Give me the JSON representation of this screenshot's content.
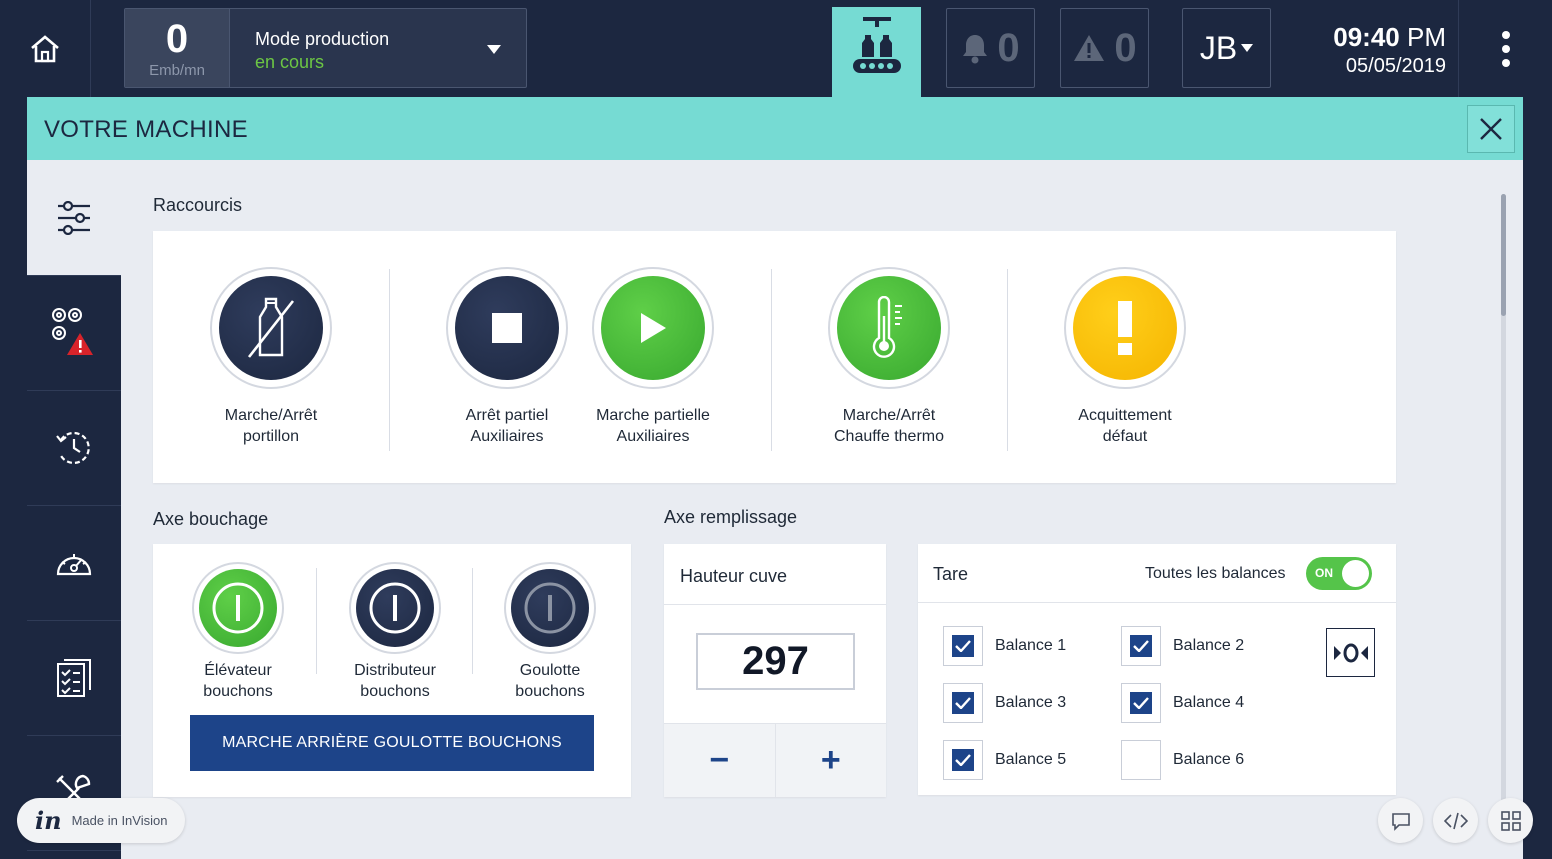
{
  "topbar": {
    "production_count": "0",
    "production_unit": "Emb/mn",
    "mode_label": "Mode production",
    "mode_status": "en cours",
    "notifications_count": "0",
    "warnings_count": "0",
    "user_initials": "JB",
    "time": "09:40",
    "ampm": "PM",
    "date": "05/05/2019"
  },
  "panel": {
    "title": "VOTRE MACHINE"
  },
  "sidebar": {
    "items": [
      {
        "icon": "settings-sliders-icon",
        "active": true
      },
      {
        "icon": "gears-warning-icon",
        "active": false
      },
      {
        "icon": "history-icon",
        "active": false
      },
      {
        "icon": "speedometer-icon",
        "active": false
      },
      {
        "icon": "checklist-icon",
        "active": false
      },
      {
        "icon": "tools-icon",
        "active": false
      }
    ]
  },
  "shortcuts": {
    "title": "Raccourcis",
    "items": [
      {
        "line1": "Marche/Arrêt",
        "line2": "portillon",
        "icon": "bottle-off-icon",
        "color": "dark"
      },
      {
        "line1": "Arrêt partiel",
        "line2": "Auxiliaires",
        "icon": "stop-icon",
        "color": "dark"
      },
      {
        "line1": "Marche partielle",
        "line2": "Auxiliaires",
        "icon": "play-icon",
        "color": "green"
      },
      {
        "line1": "Marche/Arrêt",
        "line2": "Chauffe thermo",
        "icon": "thermometer-icon",
        "color": "green"
      },
      {
        "line1": "Acquittement",
        "line2": "défaut",
        "icon": "exclamation-icon",
        "color": "yellow"
      }
    ]
  },
  "axe_bouchage": {
    "title": "Axe bouchage",
    "items": [
      {
        "line1": "Élévateur",
        "line2": "bouchons",
        "state": "on"
      },
      {
        "line1": "Distributeur",
        "line2": "bouchons",
        "state": "off"
      },
      {
        "line1": "Goulotte",
        "line2": "bouchons",
        "state": "disabled"
      }
    ],
    "reverse_button": "MARCHE ARRIÈRE GOULOTTE BOUCHONS"
  },
  "axe_remplissage": {
    "title": "Axe remplissage",
    "hauteur_title": "Hauteur cuve",
    "hauteur_value": "297",
    "minus": "−",
    "plus": "+"
  },
  "tare": {
    "title": "Tare",
    "all_label": "Toutes les balances",
    "toggle_label": "ON",
    "balances": [
      {
        "label": "Balance 1",
        "checked": true
      },
      {
        "label": "Balance 2",
        "checked": true
      },
      {
        "label": "Balance 3",
        "checked": true
      },
      {
        "label": "Balance 4",
        "checked": true
      },
      {
        "label": "Balance 5",
        "checked": true
      },
      {
        "label": "Balance 6",
        "checked": false
      }
    ]
  },
  "overlay": {
    "invision_logo": "in",
    "invision_text": "Made in InVision"
  },
  "colors": {
    "navy": "#1c2740",
    "teal": "#76dbd3",
    "green": "#38a82f",
    "yellow": "#f5b400",
    "blue": "#1d4489"
  }
}
